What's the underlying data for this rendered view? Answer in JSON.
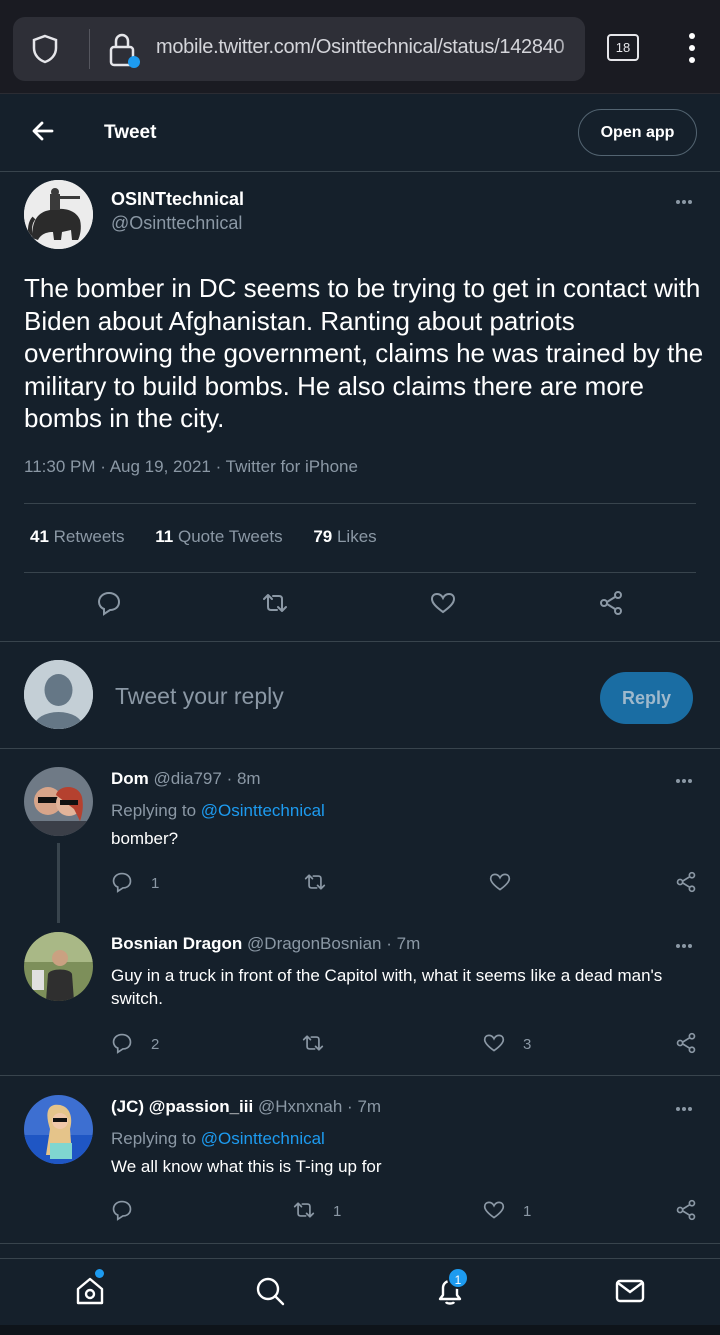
{
  "browser": {
    "url": "mobile.twitter.com/Osinttechnical/status/142840",
    "tab_count": "18"
  },
  "header": {
    "title": "Tweet",
    "open_app_label": "Open app"
  },
  "main_tweet": {
    "name": "OSINTtechnical",
    "handle": "@Osinttechnical",
    "text": "The bomber in DC seems to be trying to get in contact with Biden about Afghanistan. Ranting about patriots overthrowing the government, claims he was trained by the military to build bombs. He also claims there are more bombs in the city.",
    "time": "11:30 PM",
    "date": "Aug 19, 2021",
    "source": "Twitter for iPhone",
    "retweets": "41",
    "retweets_label": "Retweets",
    "quotes": "11",
    "quotes_label": "Quote Tweets",
    "likes": "79",
    "likes_label": "Likes"
  },
  "composer": {
    "placeholder": "Tweet your reply",
    "reply_label": "Reply"
  },
  "replies": [
    {
      "name": "Dom",
      "handle": "@dia797",
      "time": "8m",
      "replying_prefix": "Replying to",
      "replying_to": "@Osinttechnical",
      "text": "bomber?",
      "reply_count": "1",
      "retweet_count": "",
      "like_count": ""
    },
    {
      "name": "Bosnian Dragon",
      "handle": "@DragonBosnian",
      "time": "7m",
      "text": "Guy in a truck in front of the Capitol with, what it seems like a dead man's switch.",
      "reply_count": "2",
      "retweet_count": "",
      "like_count": "3"
    },
    {
      "name": "(JC) @passion_iii",
      "handle": "@Hxnxnah",
      "time": "7m",
      "replying_prefix": "Replying to",
      "replying_to": "@Osinttechnical",
      "text": "We all know what this is T-ing up for",
      "reply_count": "",
      "retweet_count": "1",
      "like_count": "1"
    }
  ],
  "bottom_nav": {
    "notifications_badge": "1"
  },
  "colors": {
    "background": "#15202b",
    "accent": "#1d9bf0",
    "muted": "#8b98a5",
    "border": "#38444d"
  }
}
